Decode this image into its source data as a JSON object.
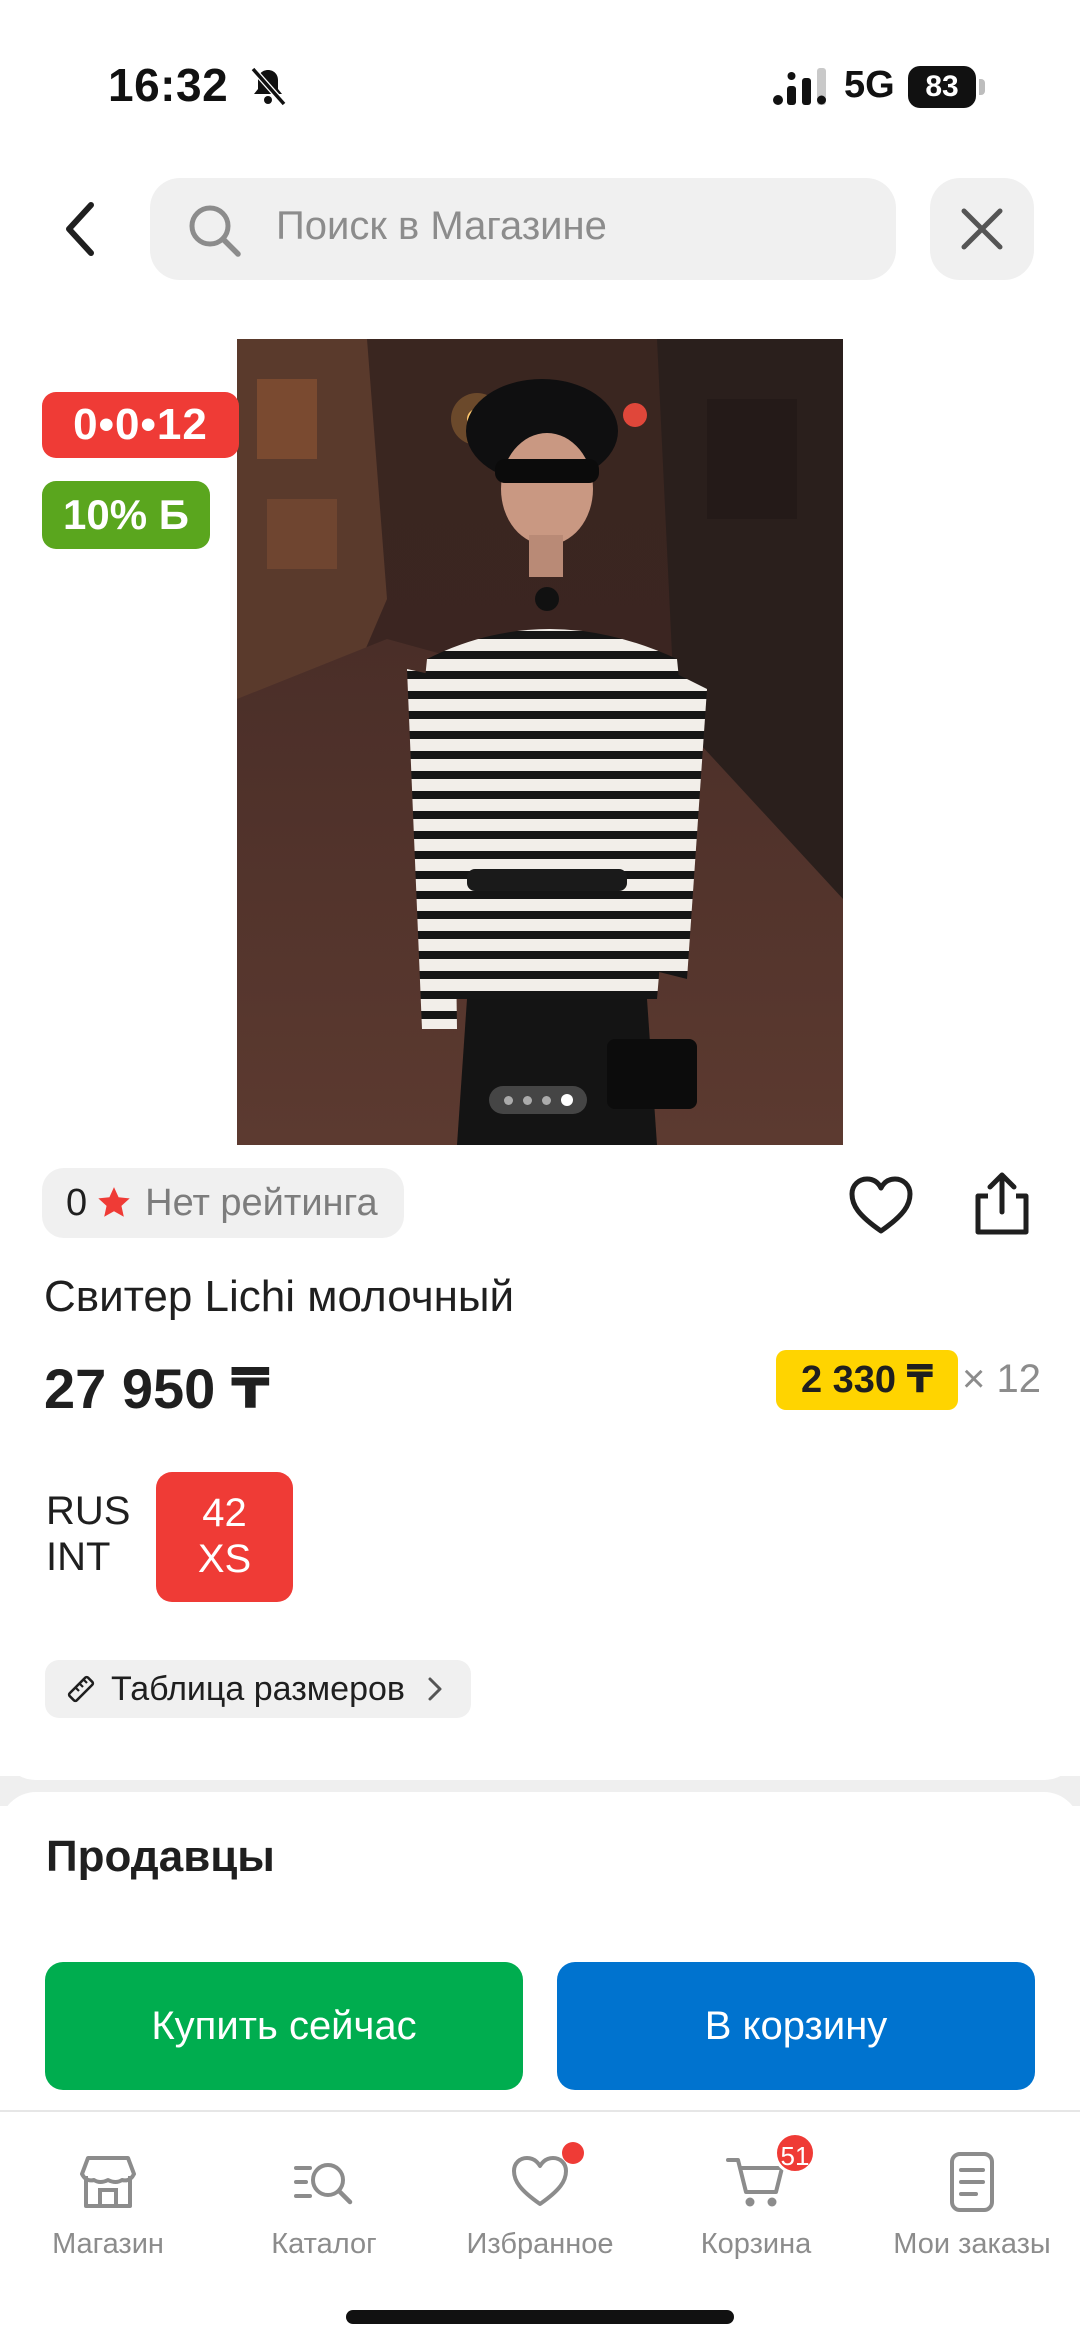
{
  "status_bar": {
    "time": "16:32",
    "network": "5G",
    "battery": "83",
    "icons": [
      "bell-off-icon",
      "signal-icon",
      "battery-icon"
    ]
  },
  "header": {
    "search_placeholder": "Поиск в Магазине",
    "icons": [
      "back-icon",
      "search-icon",
      "close-icon"
    ]
  },
  "product": {
    "image_pages": 4,
    "active_page": 4,
    "timer_badge": "0•0•12",
    "bonus_badge": "10% Б",
    "rating_count": "0",
    "rating_text": "Нет рейтинга",
    "title": "Свитер Lichi молочный",
    "price": "27 950 ₸",
    "installment_price": "2 330 ₸",
    "installment_months": "× 12",
    "size_system_1": "RUS",
    "size_system_2": "INT",
    "size_value_1": "42",
    "size_value_2": "XS",
    "size_table_label": "Таблица размеров"
  },
  "sellers": {
    "title": "Продавцы"
  },
  "actions": {
    "buy_now": "Купить сейчас",
    "add_to_cart": "В корзину"
  },
  "bottom_nav": {
    "items": [
      {
        "label": "Магазин",
        "icon": "store-icon"
      },
      {
        "label": "Каталог",
        "icon": "catalog-icon"
      },
      {
        "label": "Избранное",
        "icon": "heart-icon"
      },
      {
        "label": "Корзина",
        "icon": "cart-icon",
        "badge": "51"
      },
      {
        "label": "Мои заказы",
        "icon": "orders-icon"
      }
    ]
  },
  "colors": {
    "red": "#ef3b36",
    "green_badge": "#5aa61e",
    "buy_green": "#00ad4f",
    "cart_blue": "#0073cf",
    "installment_yellow": "#ffd400"
  }
}
